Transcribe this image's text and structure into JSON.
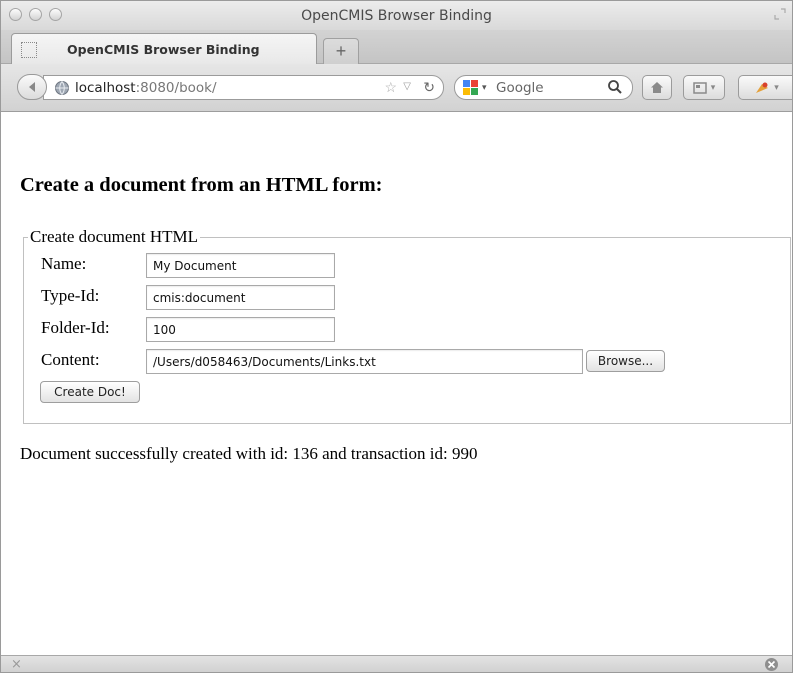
{
  "window": {
    "title": "OpenCMIS Browser Binding"
  },
  "tab": {
    "label": "OpenCMIS Browser Binding",
    "new_tab_symbol": "+"
  },
  "nav": {
    "url_host": "localhost",
    "url_rest": ":8080/book/",
    "search_placeholder": "Google"
  },
  "page": {
    "heading": "Create a document from an HTML form:",
    "legend": "Create document HTML",
    "fields": {
      "name_label": "Name:",
      "name_value": "My Document",
      "type_label": "Type-Id:",
      "type_value": "cmis:document",
      "folder_label": "Folder-Id:",
      "folder_value": "100",
      "content_label": "Content:",
      "content_value": "/Users/d058463/Documents/Links.txt"
    },
    "browse_button": "Browse...",
    "submit_button": "Create Doc!",
    "status_message": "Document successfully created with id: 136 and transaction id: 990"
  },
  "statusbar": {
    "close_symbol": "×"
  },
  "colors": {
    "chrome": "#d3d3d3",
    "text": "#000000",
    "field_border": "#a9a9a9"
  }
}
